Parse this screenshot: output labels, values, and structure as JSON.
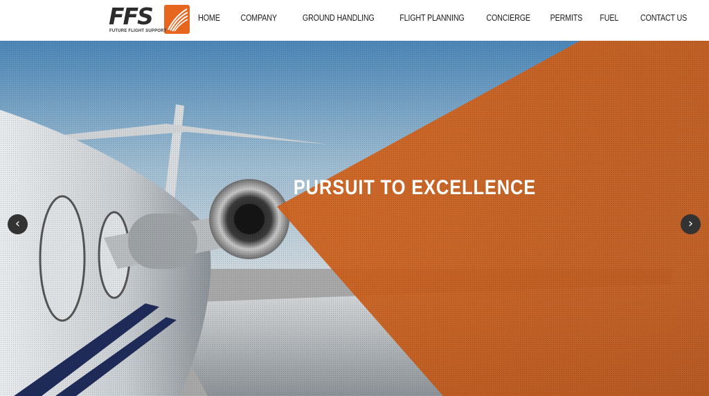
{
  "header": {
    "logo": {
      "letters": "FFS",
      "tagline": "FUTURE FLIGHT SUPPORT",
      "icon": "wing-logo-icon"
    },
    "nav": [
      {
        "label": "HOME"
      },
      {
        "label": "COMPANY"
      },
      {
        "label": "GROUND HANDLING"
      },
      {
        "label": "FLIGHT PLANNING"
      },
      {
        "label": "CONCIERGE"
      },
      {
        "label": "PERMITS"
      },
      {
        "label": "FUEL"
      },
      {
        "label": "CONTACT US"
      }
    ]
  },
  "hero": {
    "title": "PURSUIT TO EXCELLENCE",
    "prev_icon": "chevron-left-icon",
    "next_icon": "chevron-right-icon",
    "image": "private-jet-engine-photo"
  },
  "colors": {
    "brand_orange": "#e6661f",
    "overlay_orange": "#d2621d",
    "nav_text": "#1c1c1c",
    "arrow_bg": "#333333"
  }
}
